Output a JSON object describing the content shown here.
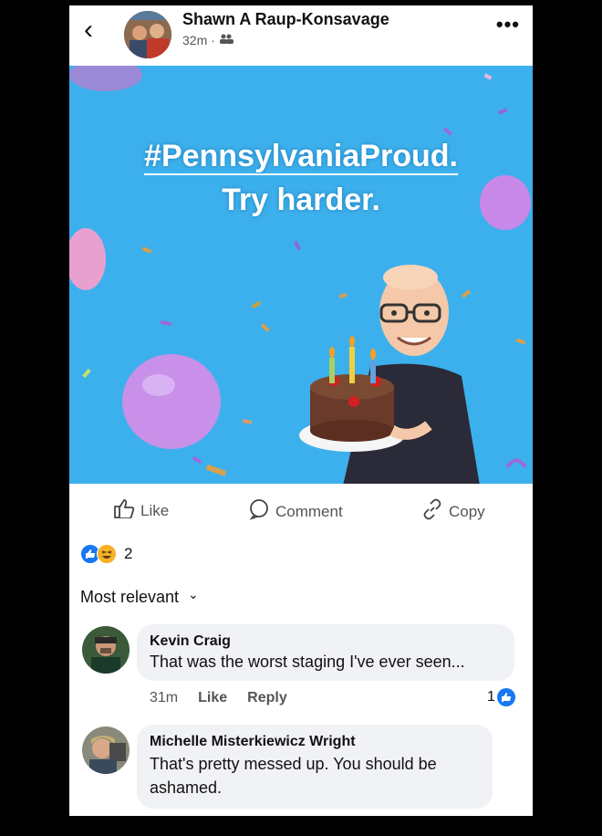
{
  "header": {
    "author": "Shawn A Raup-Konsavage",
    "time": "32m",
    "separator": "·",
    "more": "•••",
    "back": "‹"
  },
  "post_image": {
    "hashtag": "#PennsylvaniaProud.",
    "line2": "Try harder."
  },
  "actions": {
    "like": "Like",
    "comment": "Comment",
    "copy": "Copy"
  },
  "reactions": {
    "count": "2"
  },
  "sort": {
    "label": "Most relevant",
    "chevron": "⌄"
  },
  "comments": [
    {
      "name": "Kevin Craig",
      "text": "That was the worst staging I've ever seen...",
      "time": "31m",
      "like": "Like",
      "reply": "Reply",
      "likes": "1"
    },
    {
      "name": "Michelle Misterkiewicz Wright",
      "text": "That's pretty messed up.  You should be ashamed."
    }
  ],
  "colors": {
    "facebook_blue": "#1877f2",
    "image_bg": "#3cb0ec",
    "bubble": "#f0f2f5"
  }
}
